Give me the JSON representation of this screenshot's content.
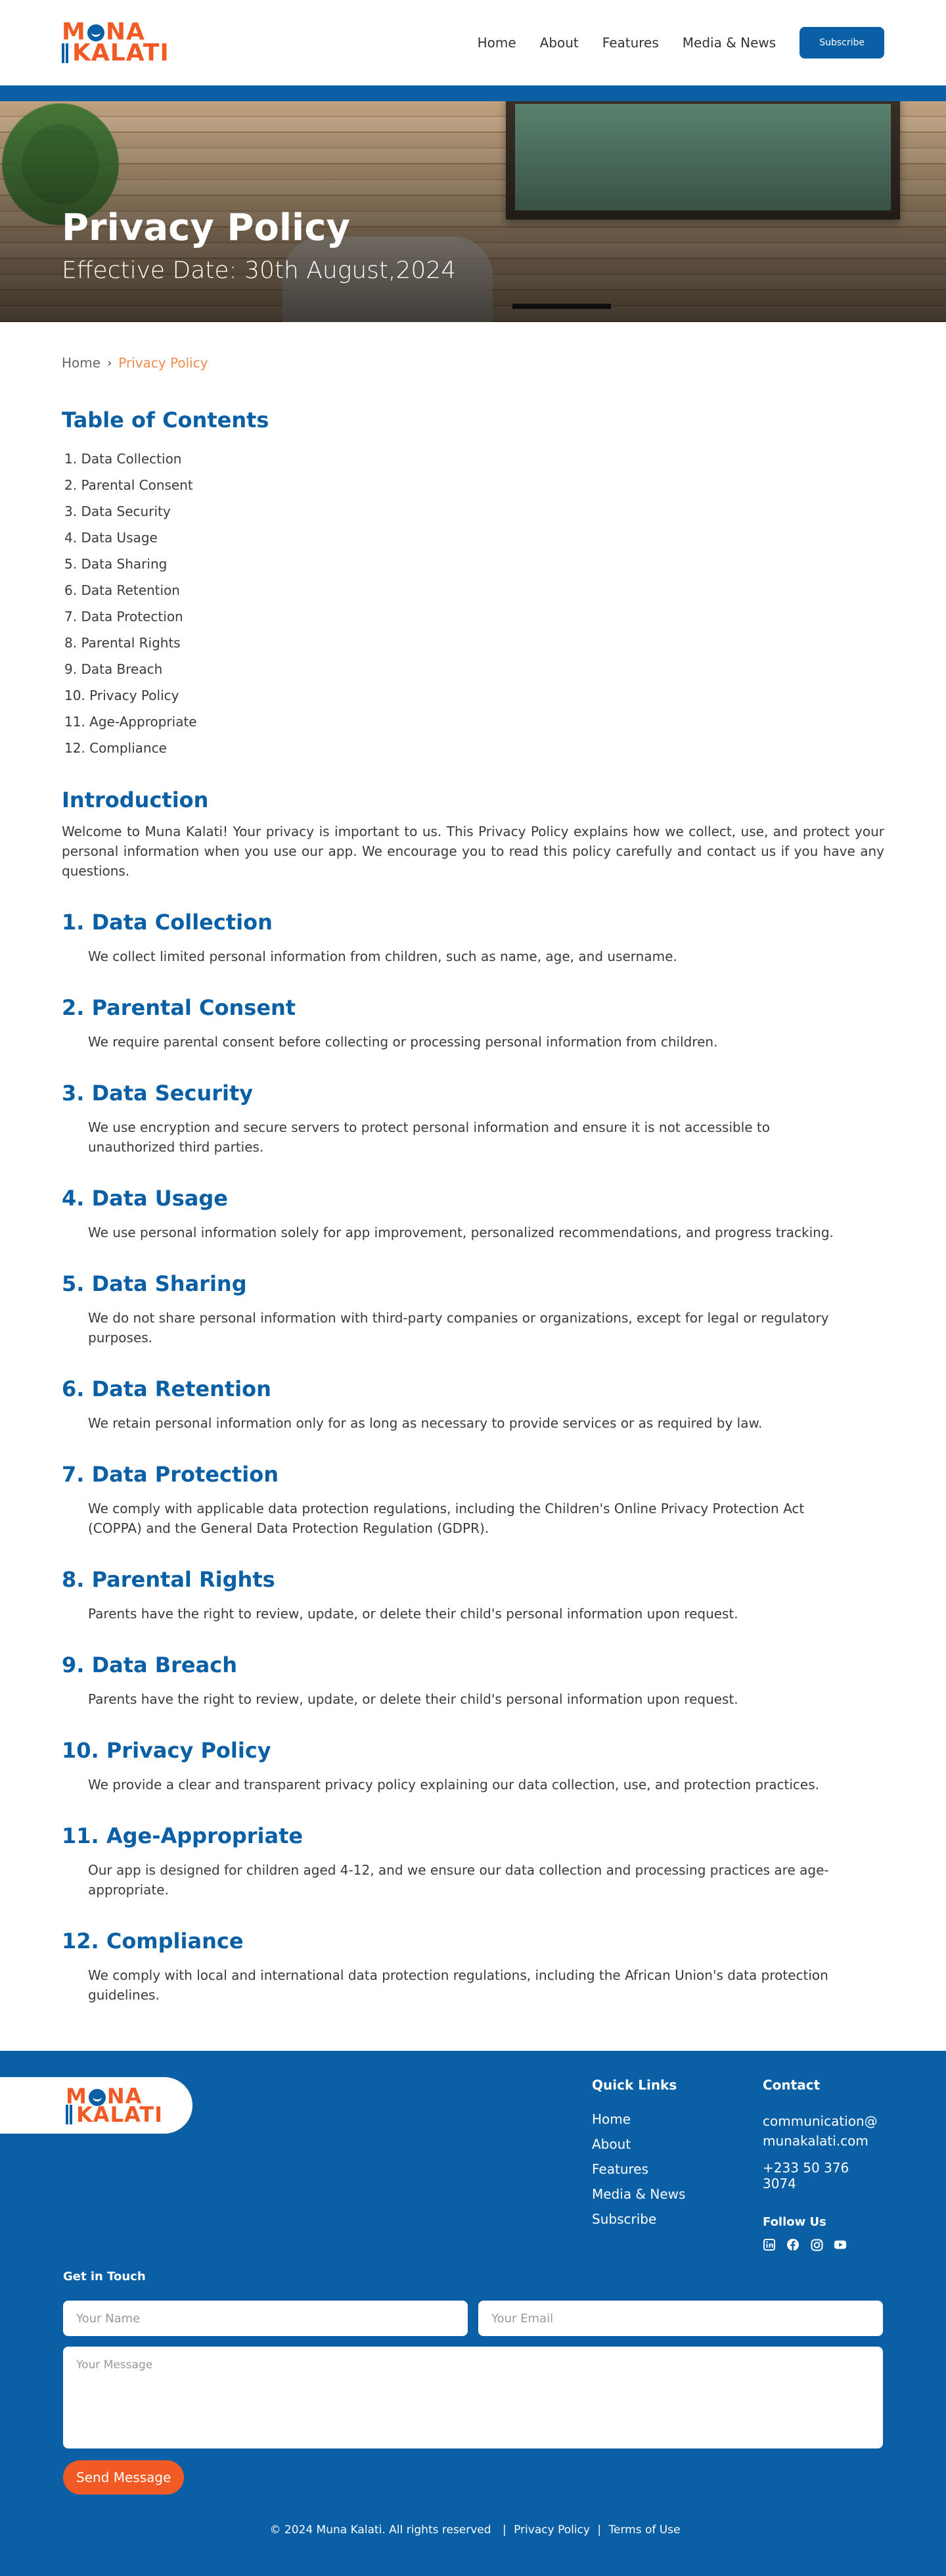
{
  "header": {
    "logo_line1": "MUNA",
    "logo_line2": "KALATI",
    "nav": [
      "Home",
      "About",
      "Features",
      "Media & News"
    ],
    "subscribe": "Subscribe"
  },
  "hero": {
    "title": "Privacy Policy",
    "subtitle": "Effective Date: 30th August,2024"
  },
  "breadcrumb": {
    "home": "Home",
    "current": "Privacy Policy"
  },
  "toc": {
    "title": "Table of Contents",
    "items": [
      "1. Data Collection",
      "2. Parental Consent",
      "3. Data Security",
      "4. Data Usage",
      "5. Data Sharing",
      "6. Data Retention",
      "7. Data Protection",
      "8. Parental Rights",
      "9. Data Breach",
      "10. Privacy Policy",
      "11. Age-Appropriate",
      "12. Compliance"
    ]
  },
  "intro": {
    "title": "Introduction",
    "text": "Welcome to Muna Kalati! Your privacy is important to us. This Privacy Policy explains how we collect, use, and protect your personal information when you use our app. We encourage you to read this policy carefully and contact us if you have any questions."
  },
  "sections": [
    {
      "title": "1. Data Collection",
      "text": "We collect limited personal information from children, such as name, age, and username."
    },
    {
      "title": "2. Parental Consent",
      "text": "We require parental consent before collecting or processing personal information from children."
    },
    {
      "title": "3. Data Security",
      "text": "We use encryption and secure servers to protect personal information and ensure it is not accessible to unauthorized third parties."
    },
    {
      "title": "4. Data Usage",
      "text": "We use personal information solely for app improvement, personalized recommendations, and progress tracking."
    },
    {
      "title": "5. Data Sharing",
      "text": "We do not share personal information with third-party companies or organizations, except for legal or regulatory purposes."
    },
    {
      "title": "6. Data Retention",
      "text": "We retain personal information only for as long as necessary to provide services or as required by law."
    },
    {
      "title": "7. Data Protection",
      "text": "We comply with applicable data protection regulations, including the Children's Online Privacy Protection Act (COPPA) and the General Data Protection Regulation (GDPR)."
    },
    {
      "title": "8. Parental Rights",
      "text": "Parents have the right to review, update, or delete their child's personal information upon request."
    },
    {
      "title": "9. Data Breach",
      "text": "Parents have the right to review, update, or delete their child's personal information upon request."
    },
    {
      "title": "10. Privacy Policy",
      "text": "We provide a clear and transparent privacy policy explaining our data collection, use, and protection practices."
    },
    {
      "title": "11. Age-Appropriate",
      "text": "Our app is designed for children aged 4-12, and we ensure our data collection and processing practices are age-appropriate."
    },
    {
      "title": "12. Compliance",
      "text": "We comply with local and international data protection regulations, including the African Union's data protection guidelines."
    }
  ],
  "footer": {
    "quick_links_title": "Quick Links",
    "quick_links": [
      "Home",
      "About",
      "Features",
      "Media & News",
      "Subscribe"
    ],
    "contact_title": "Contact",
    "email_line1": "communication@",
    "email_line2": "munakalati.com",
    "phone": "+233 50 376 3074",
    "follow_title": "Follow Us",
    "socials": [
      "linkedin-icon",
      "facebook-icon",
      "instagram-icon",
      "youtube-icon"
    ],
    "get_in_touch": "Get in Touch",
    "name_placeholder": "Your Name",
    "email_placeholder": "Your Email",
    "message_placeholder": "Your Message",
    "send": "Send Message",
    "copyright": "© 2024 Muna Kalati. All rights reserved",
    "sep": "|",
    "privacy": "Privacy Policy",
    "terms": "Terms of Use"
  },
  "colors": {
    "brand_blue": "#0b5fa5",
    "brand_orange": "#f15a24",
    "breadcrumb_current": "#f28a4c"
  }
}
